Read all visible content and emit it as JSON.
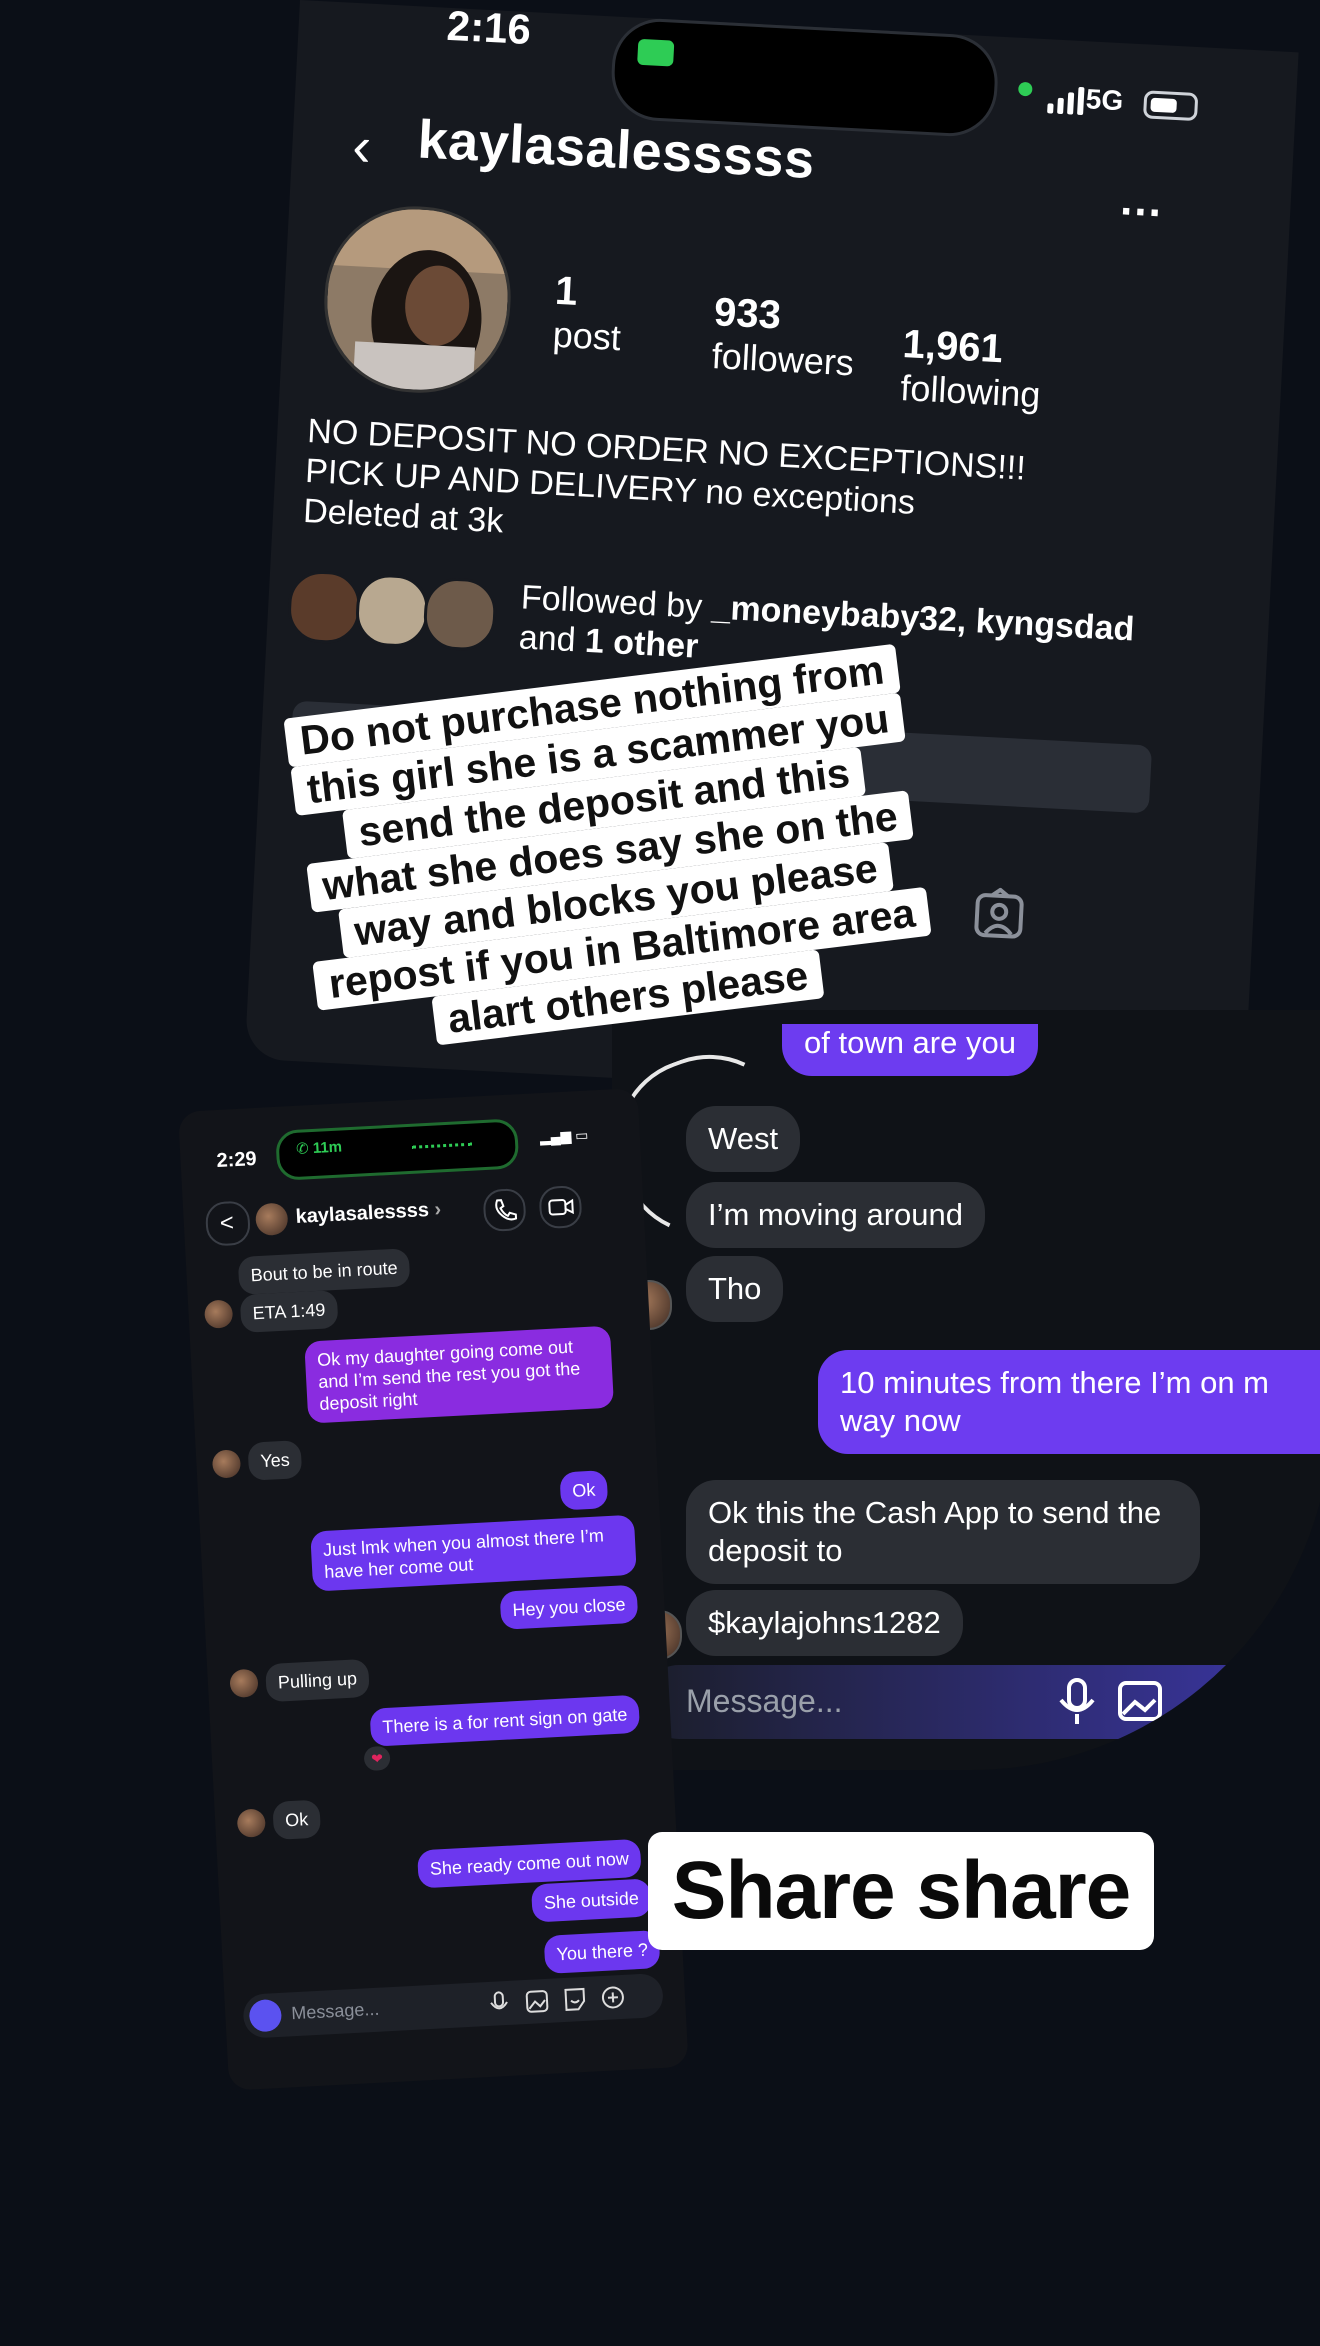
{
  "profile": {
    "status_time": "2:16",
    "network": "5G",
    "username": "kaylasalesssss",
    "more": "...",
    "stats": {
      "posts_count": "1",
      "posts_label": "post",
      "followers_count": "933",
      "followers_label": "followers",
      "following_count": "1,961",
      "following_label": "following"
    },
    "bio_lines": [
      "NO DEPOSIT NO ORDER NO EXCEPTIONS!!!",
      "PICK UP AND DELIVERY no exceptions",
      "Deleted at 3k"
    ],
    "followed_by": {
      "prefix": "Followed by",
      "names": "_moneybaby32, kyngsdad",
      "and": "and",
      "other": "1 other"
    }
  },
  "warning_lines": [
    "Do not purchase nothing from",
    "this girl she is a scammer you",
    "send the deposit and this",
    "what she does say she on the",
    "way and blocks you please",
    "repost if you in Baltimore area",
    "alart others please"
  ],
  "zoom_chat": {
    "messages": [
      {
        "from": "them",
        "text": "of town are you"
      },
      {
        "from": "them",
        "text": "West"
      },
      {
        "from": "them",
        "text": "I’m moving around"
      },
      {
        "from": "them",
        "text": "Tho"
      },
      {
        "from": "me",
        "text": "10 minutes from there I’m on m"
      },
      {
        "from": "me",
        "text": "way now"
      },
      {
        "from": "them",
        "text": "Ok this the Cash App to send the"
      },
      {
        "from": "them",
        "text": "deposit to"
      },
      {
        "from": "them",
        "text": "$kaylajohns1282"
      }
    ],
    "input_placeholder": "Message..."
  },
  "small_chat": {
    "status_time": "2:29",
    "call_timer": "11m",
    "back": "<",
    "contact_name": "kaylasalessss",
    "contact_chevron": "›",
    "messages": [
      {
        "from": "them",
        "text": "Bout to be in route"
      },
      {
        "from": "them",
        "text": "ETA 1:49"
      },
      {
        "from": "me",
        "text": "Ok my daughter going come out and I’m send the rest you got the deposit right"
      },
      {
        "from": "them",
        "text": "Yes"
      },
      {
        "from": "me",
        "text": "Ok"
      },
      {
        "from": "me",
        "text": "Just lmk when you almost there I’m have her come out"
      },
      {
        "from": "me",
        "text": "Hey you close"
      },
      {
        "from": "them",
        "text": "Pulling up"
      },
      {
        "from": "me",
        "text": "There is a for rent sign on gate"
      },
      {
        "from": "them",
        "text": "Ok"
      },
      {
        "from": "me",
        "text": "She ready come out now"
      },
      {
        "from": "me",
        "text": "She outside"
      },
      {
        "from": "me",
        "text": "You there ?"
      }
    ],
    "reaction": "❤",
    "input_placeholder": "Message..."
  },
  "share_caption": "Share share",
  "colors": {
    "outgoing": "#6d3cf0",
    "incoming": "#2b2e34",
    "background": "#0b0f17",
    "live": "#2ecc55"
  },
  "icons": [
    "back-chevron-icon",
    "more-icon",
    "camera-icon",
    "signal-icon",
    "battery-icon",
    "tagged-icon",
    "phone-icon",
    "video-icon",
    "mic-icon",
    "gallery-icon",
    "sticker-icon",
    "plus-icon"
  ]
}
